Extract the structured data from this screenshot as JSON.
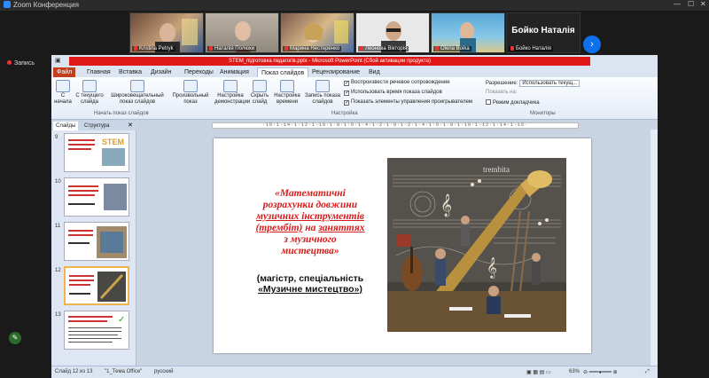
{
  "zoom": {
    "window_title": "Zoom Конференция",
    "recording_label": "Запись",
    "participants": [
      {
        "name": "Kristina Petryk"
      },
      {
        "name": "Наталія Полюхи"
      },
      {
        "name": "Марина Нестеренко"
      },
      {
        "name": "Леонова Вікторія"
      },
      {
        "name": "Olena Boika"
      },
      {
        "name": "Бойко Наталія",
        "display": "Бойко Наталія"
      }
    ]
  },
  "ppt": {
    "title_bar": "STEM_підготовка педагогів.pptx - Microsoft PowerPoint (Сбой активации продукта)",
    "tabs": [
      "Файл",
      "Главная",
      "Вставка",
      "Дизайн",
      "Переходы",
      "Анимация",
      "Показ слайдов",
      "Рецензирование",
      "Вид"
    ],
    "ribbon": {
      "start_buttons": [
        "С начала",
        "С текущего слайда",
        "Широковещательный показ слайдов",
        "Произвольный показ"
      ],
      "start_group": "Начать показ слайдов",
      "setup_buttons": [
        "Настройка демонстрации",
        "Скрыть слайд",
        "Настройка времени",
        "Запись показа слайдов"
      ],
      "checkboxes": [
        "Воспроизвести речевое сопровождение",
        "Использовать время показа слайдов",
        "Показать элементы управления проигрывателем"
      ],
      "setup_group": "Настройка",
      "resolution_label": "Разрешение:",
      "resolution_value": "Использовать текущ...",
      "show_on_label": "Показать на:",
      "presenter_view": "Режим докладчика",
      "monitors_group": "Мониторы"
    },
    "pane_tabs": [
      "Слайды",
      "Структура"
    ],
    "thumb_numbers": [
      "9",
      "10",
      "11",
      "12",
      "13"
    ],
    "ruler_text": "·16·1·14·1·12·1·10·1·8·1·6·1·4·1·2·1·0·1·2·1·4·1·6·1·8·1·10·1·12·1·14·1·16·",
    "slide": {
      "title_l1": "«Математичні",
      "title_l2": "розрахунки довжини",
      "title_l3": "музичних інструментів",
      "title_l4": "(трембіт)",
      "title_l4b": " на ",
      "title_l4c": "заняттях",
      "title_l5": "з музичного",
      "title_l6": "мистецтва»",
      "sub_l1": "(магістр, спеціальність",
      "sub_l2": "«Музичне мистецтво»)",
      "art_word": "trembita"
    },
    "status": {
      "slide": "Слайд 12 из 13",
      "theme": "\"1_Тема Office\"",
      "lang": "русский",
      "zoom": "63%"
    }
  }
}
